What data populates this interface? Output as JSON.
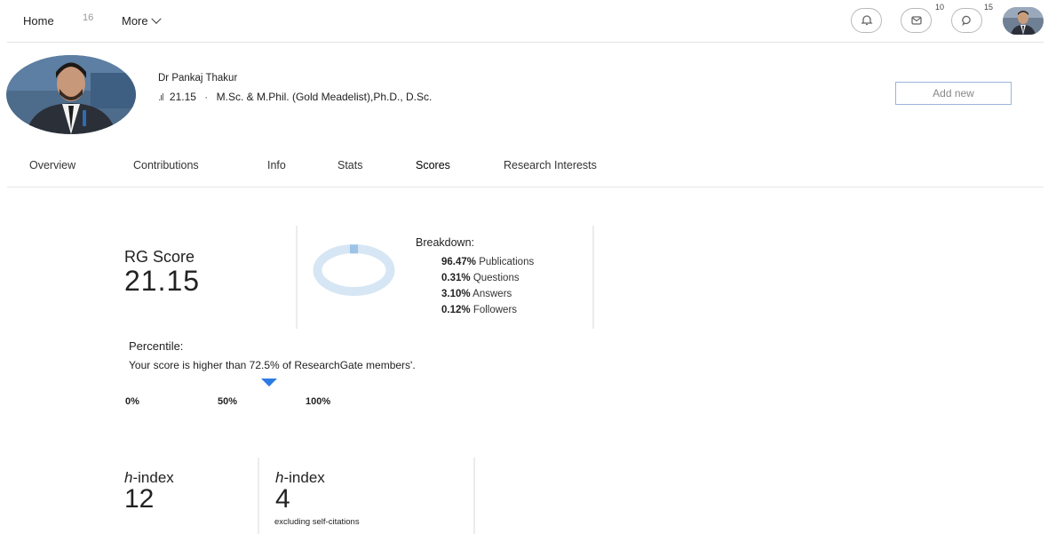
{
  "nav": {
    "home": "Home",
    "home_count": "16",
    "more": "More",
    "messages_badge": "10",
    "questions_badge": "15"
  },
  "profile": {
    "name": "Dr Pankaj Thakur",
    "rg_score": "21.15",
    "separator": "·",
    "qualifications": "M.Sc. & M.Phil. (Gold Meadelist),Ph.D., D.Sc.",
    "add_new": "Add new"
  },
  "tabs": [
    "Overview",
    "Contributions",
    "Info",
    "Stats",
    "Scores",
    "Research Interests"
  ],
  "active_tab": "Scores",
  "score": {
    "label": "RG Score",
    "value": "21.15"
  },
  "breakdown": {
    "title": "Breakdown:",
    "items": [
      {
        "percent": "96.47%",
        "label": "Publications"
      },
      {
        "percent": "0.31%",
        "label": "Questions"
      },
      {
        "percent": "3.10%",
        "label": "Answers"
      },
      {
        "percent": "0.12%",
        "label": "Followers"
      }
    ]
  },
  "percentile": {
    "title": "Percentile:",
    "text": "Your score is higher than 72.5% of ResearchGate members'.",
    "value_percent": 72.5,
    "ticks": [
      "0%",
      "50%",
      "100%"
    ]
  },
  "hindex": [
    {
      "prefix": "h",
      "label": "-index",
      "value": "12",
      "note": ""
    },
    {
      "prefix": "h",
      "label": "-index",
      "value": "4",
      "note": "excluding self-citations"
    }
  ],
  "colors": {
    "accent": "#2c7be5",
    "donut": "#d6e6f4",
    "donut_highlight": "#9dc3e6",
    "button_border": "#9ab6dd"
  },
  "icons": {
    "feed": "bell-icon",
    "messages": "envelope-icon",
    "questions": "chat-bubble-icon"
  }
}
